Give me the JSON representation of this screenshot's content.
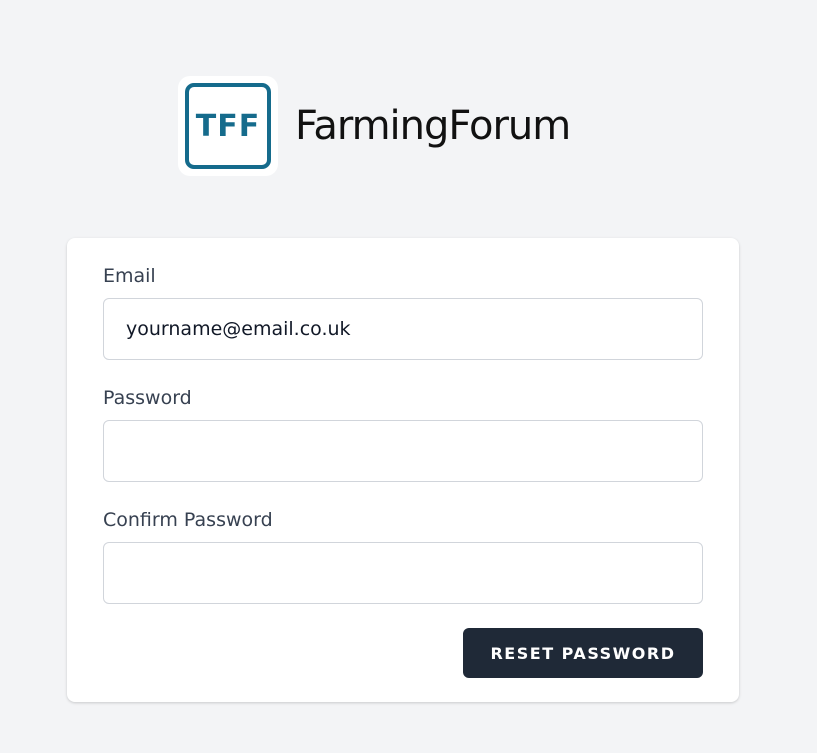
{
  "logo": {
    "mark_text": "TFF",
    "brand_name": "FarmingForum",
    "accent_color": "#156b8c"
  },
  "form": {
    "email": {
      "label": "Email",
      "value": "yourname@email.co.uk",
      "placeholder": ""
    },
    "password": {
      "label": "Password",
      "value": "",
      "placeholder": ""
    },
    "confirm_password": {
      "label": "Confirm Password",
      "value": "",
      "placeholder": ""
    },
    "submit_label": "RESET PASSWORD"
  },
  "colors": {
    "background": "#f3f4f6",
    "button": "#1f2937"
  }
}
